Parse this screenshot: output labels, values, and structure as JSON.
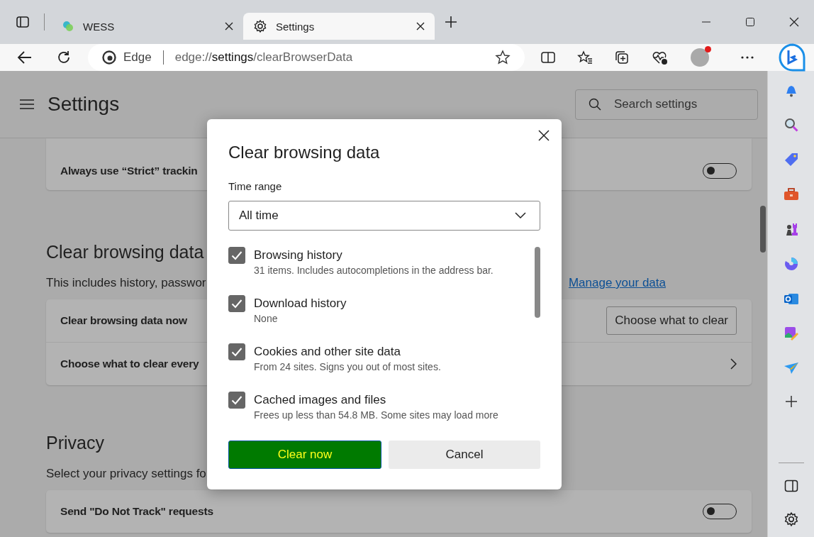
{
  "tabs": [
    {
      "title": "WESS",
      "selected": false
    },
    {
      "title": "Settings",
      "selected": true
    }
  ],
  "address": {
    "brand": "Edge",
    "url": "edge://**settings**/clearBrowserData"
  },
  "settings": {
    "title": "Settings",
    "search": {
      "placeholder": "Search settings"
    },
    "tracking_row": {
      "label": "Always use “Strict” trackin",
      "on": false
    },
    "clear_section": {
      "heading": "Clear browsing data",
      "description": "This includes history, passwor",
      "link": "Manage your data",
      "rows": [
        {
          "label": "Clear browsing data now",
          "button": "Choose what to clear"
        },
        {
          "label": "Choose what to clear every"
        }
      ]
    },
    "privacy_section": {
      "heading": "Privacy",
      "description": "Select your privacy settings fo",
      "rows": [
        {
          "label": "Send \"Do Not Track\" requests",
          "on": false
        }
      ]
    }
  },
  "dialog": {
    "title": "Clear browsing data",
    "time_range": {
      "label": "Time range",
      "value": "All time"
    },
    "items": [
      {
        "label": "Browsing history",
        "detail": "31 items. Includes autocompletions in the address bar.",
        "checked": true
      },
      {
        "label": "Download history",
        "detail": "None",
        "checked": true
      },
      {
        "label": "Cookies and other site data",
        "detail": "From 24 sites. Signs you out of most sites.",
        "checked": true
      },
      {
        "label": "Cached images and files",
        "detail": "Frees up less than 54.8 MB. Some sites may load more",
        "checked": true
      }
    ],
    "buttons": [
      {
        "label": "Clear now",
        "kind": "primary"
      },
      {
        "label": "Cancel",
        "kind": "secondary"
      }
    ]
  }
}
